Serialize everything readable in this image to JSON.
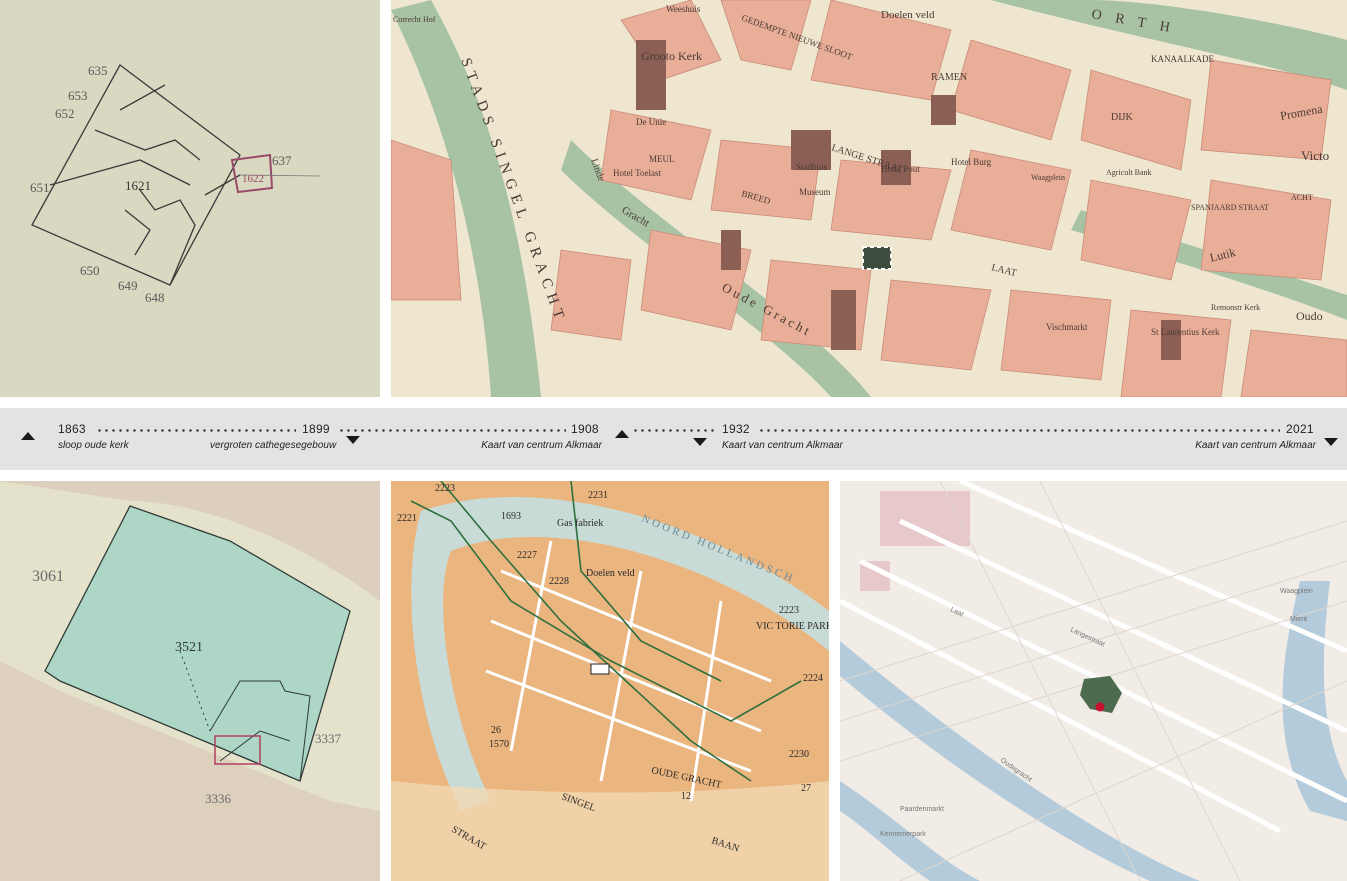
{
  "timeline": {
    "entries": [
      {
        "year": "1863",
        "caption": "sloop oude kerk"
      },
      {
        "year": "1899",
        "caption": "vergroten  cathegesegebouw"
      },
      {
        "year": "1908",
        "caption": "Kaart van centrum Alkmaar"
      },
      {
        "year": "1932",
        "caption": "Kaart van centrum Alkmaar"
      },
      {
        "year": "2021",
        "caption": "Kaart van centrum Alkmaar"
      }
    ],
    "icons": {
      "up": "triangle-up-icon",
      "down": "triangle-down-icon"
    }
  },
  "maps": {
    "m1863": {
      "labels": [
        "635",
        "653",
        "652",
        "651",
        "1621",
        "1622",
        "637",
        "650",
        "649",
        "648"
      ],
      "colors": {
        "paper": "#d9d8c0",
        "ink": "#3a3a3a",
        "accent": "#9a4a68"
      }
    },
    "m1908": {
      "labels": [
        "STADS SINGEL GRACHT",
        "Grooto Kerk",
        "Doelen veld",
        "GEDEMPTE NIEUWE SLOOT",
        "RAMEN",
        "KANAALKADE",
        "DIJK",
        "LANGE STRAAT",
        "Stadhuis",
        "Hotel Toelast",
        "Oude Gracht",
        "LAAT",
        "Lutik",
        "Oudo",
        "Victo",
        "Promena",
        "ORTH",
        "St Laurentius Kerk",
        "Vischmarkt",
        "Hotel Burg",
        "Hotel Pout",
        "Museum",
        "De Unie",
        "Linde",
        "Gracht",
        "MEUL",
        "BREED",
        "SPANJAARD STRAAT",
        "ACHT",
        "Waagplein",
        "Agricult Bank",
        "Weeshuis",
        "Correcht Hof",
        "Remonstr Kerk"
      ],
      "colors": {
        "paper": "#efe6cf",
        "block": "#e9ae97",
        "water": "#a8c3a4",
        "building": "#8b5f54"
      }
    },
    "m1899": {
      "labels": [
        "3061",
        "3521",
        "3337",
        "3336"
      ],
      "colors": {
        "paper": "#e5e2cc",
        "parcel": "#aed6c6",
        "road": "#d7c3b3"
      }
    },
    "m1932": {
      "labels": [
        "2223",
        "2231",
        "1693",
        "Gas fabriek",
        "2227",
        "Doelen veld",
        "2228",
        "VIC TORIE PARK",
        "2223",
        "2224",
        "OUDE GRACHT",
        "12",
        "2230",
        "27",
        "1570",
        "26",
        "NOORD HOLLANDSCH",
        "BAAN",
        "SINGEL",
        "STRAAT",
        "2221"
      ],
      "colors": {
        "paper": "#eab57e",
        "water": "#c9dbd6",
        "road": "#ffffff",
        "tram": "#2f6f3f"
      }
    },
    "m2021": {
      "labels": [
        "Laat",
        "Oudegracht",
        "Langestraat",
        "Kennemerpark",
        "Paardenmarkt",
        "Waagplein",
        "Mient"
      ],
      "colors": {
        "paper": "#f1ece6",
        "water": "#b4cbdc",
        "road": "#ffffff",
        "marker": "#c8102e",
        "building": "#4c6b4f"
      }
    }
  }
}
